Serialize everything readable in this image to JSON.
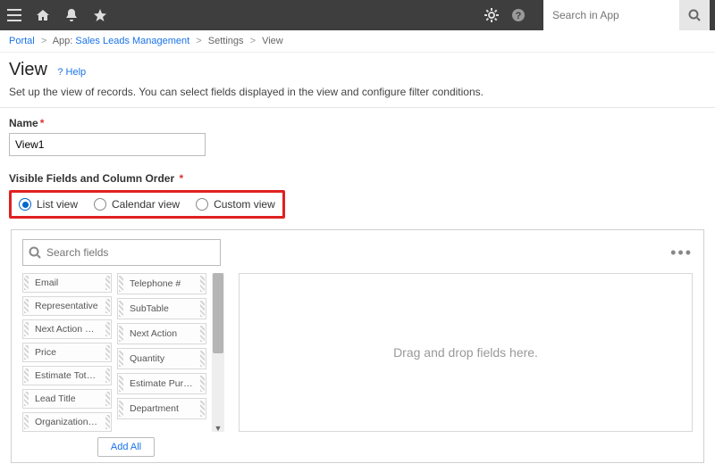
{
  "search": {
    "placeholder": "Search in App"
  },
  "breadcrumb": {
    "portal": "Portal",
    "app_prefix": "App:",
    "app_name": "Sales Leads Management",
    "settings": "Settings",
    "view": "View"
  },
  "page": {
    "title": "View",
    "help": "? Help",
    "description": "Set up the view of records. You can select fields displayed in the view and configure filter conditions."
  },
  "name": {
    "label": "Name",
    "value": "View1"
  },
  "visible": {
    "label": "Visible Fields and Column Order",
    "options": {
      "list": "List view",
      "calendar": "Calendar view",
      "custom": "Custom view"
    },
    "selected": "list"
  },
  "fields": {
    "search_placeholder": "Search fields",
    "left": [
      "Email",
      "Representative",
      "Next Action Date",
      "Price",
      "Estimate Total Sales",
      "Lead Title",
      "Organization Name"
    ],
    "right": [
      "Telephone #",
      "SubTable",
      "Next Action",
      "Quantity",
      "Estimate Purchase D...",
      "Department"
    ],
    "add_all": "Add All"
  },
  "dropzone": {
    "text": "Drag and drop fields here."
  }
}
